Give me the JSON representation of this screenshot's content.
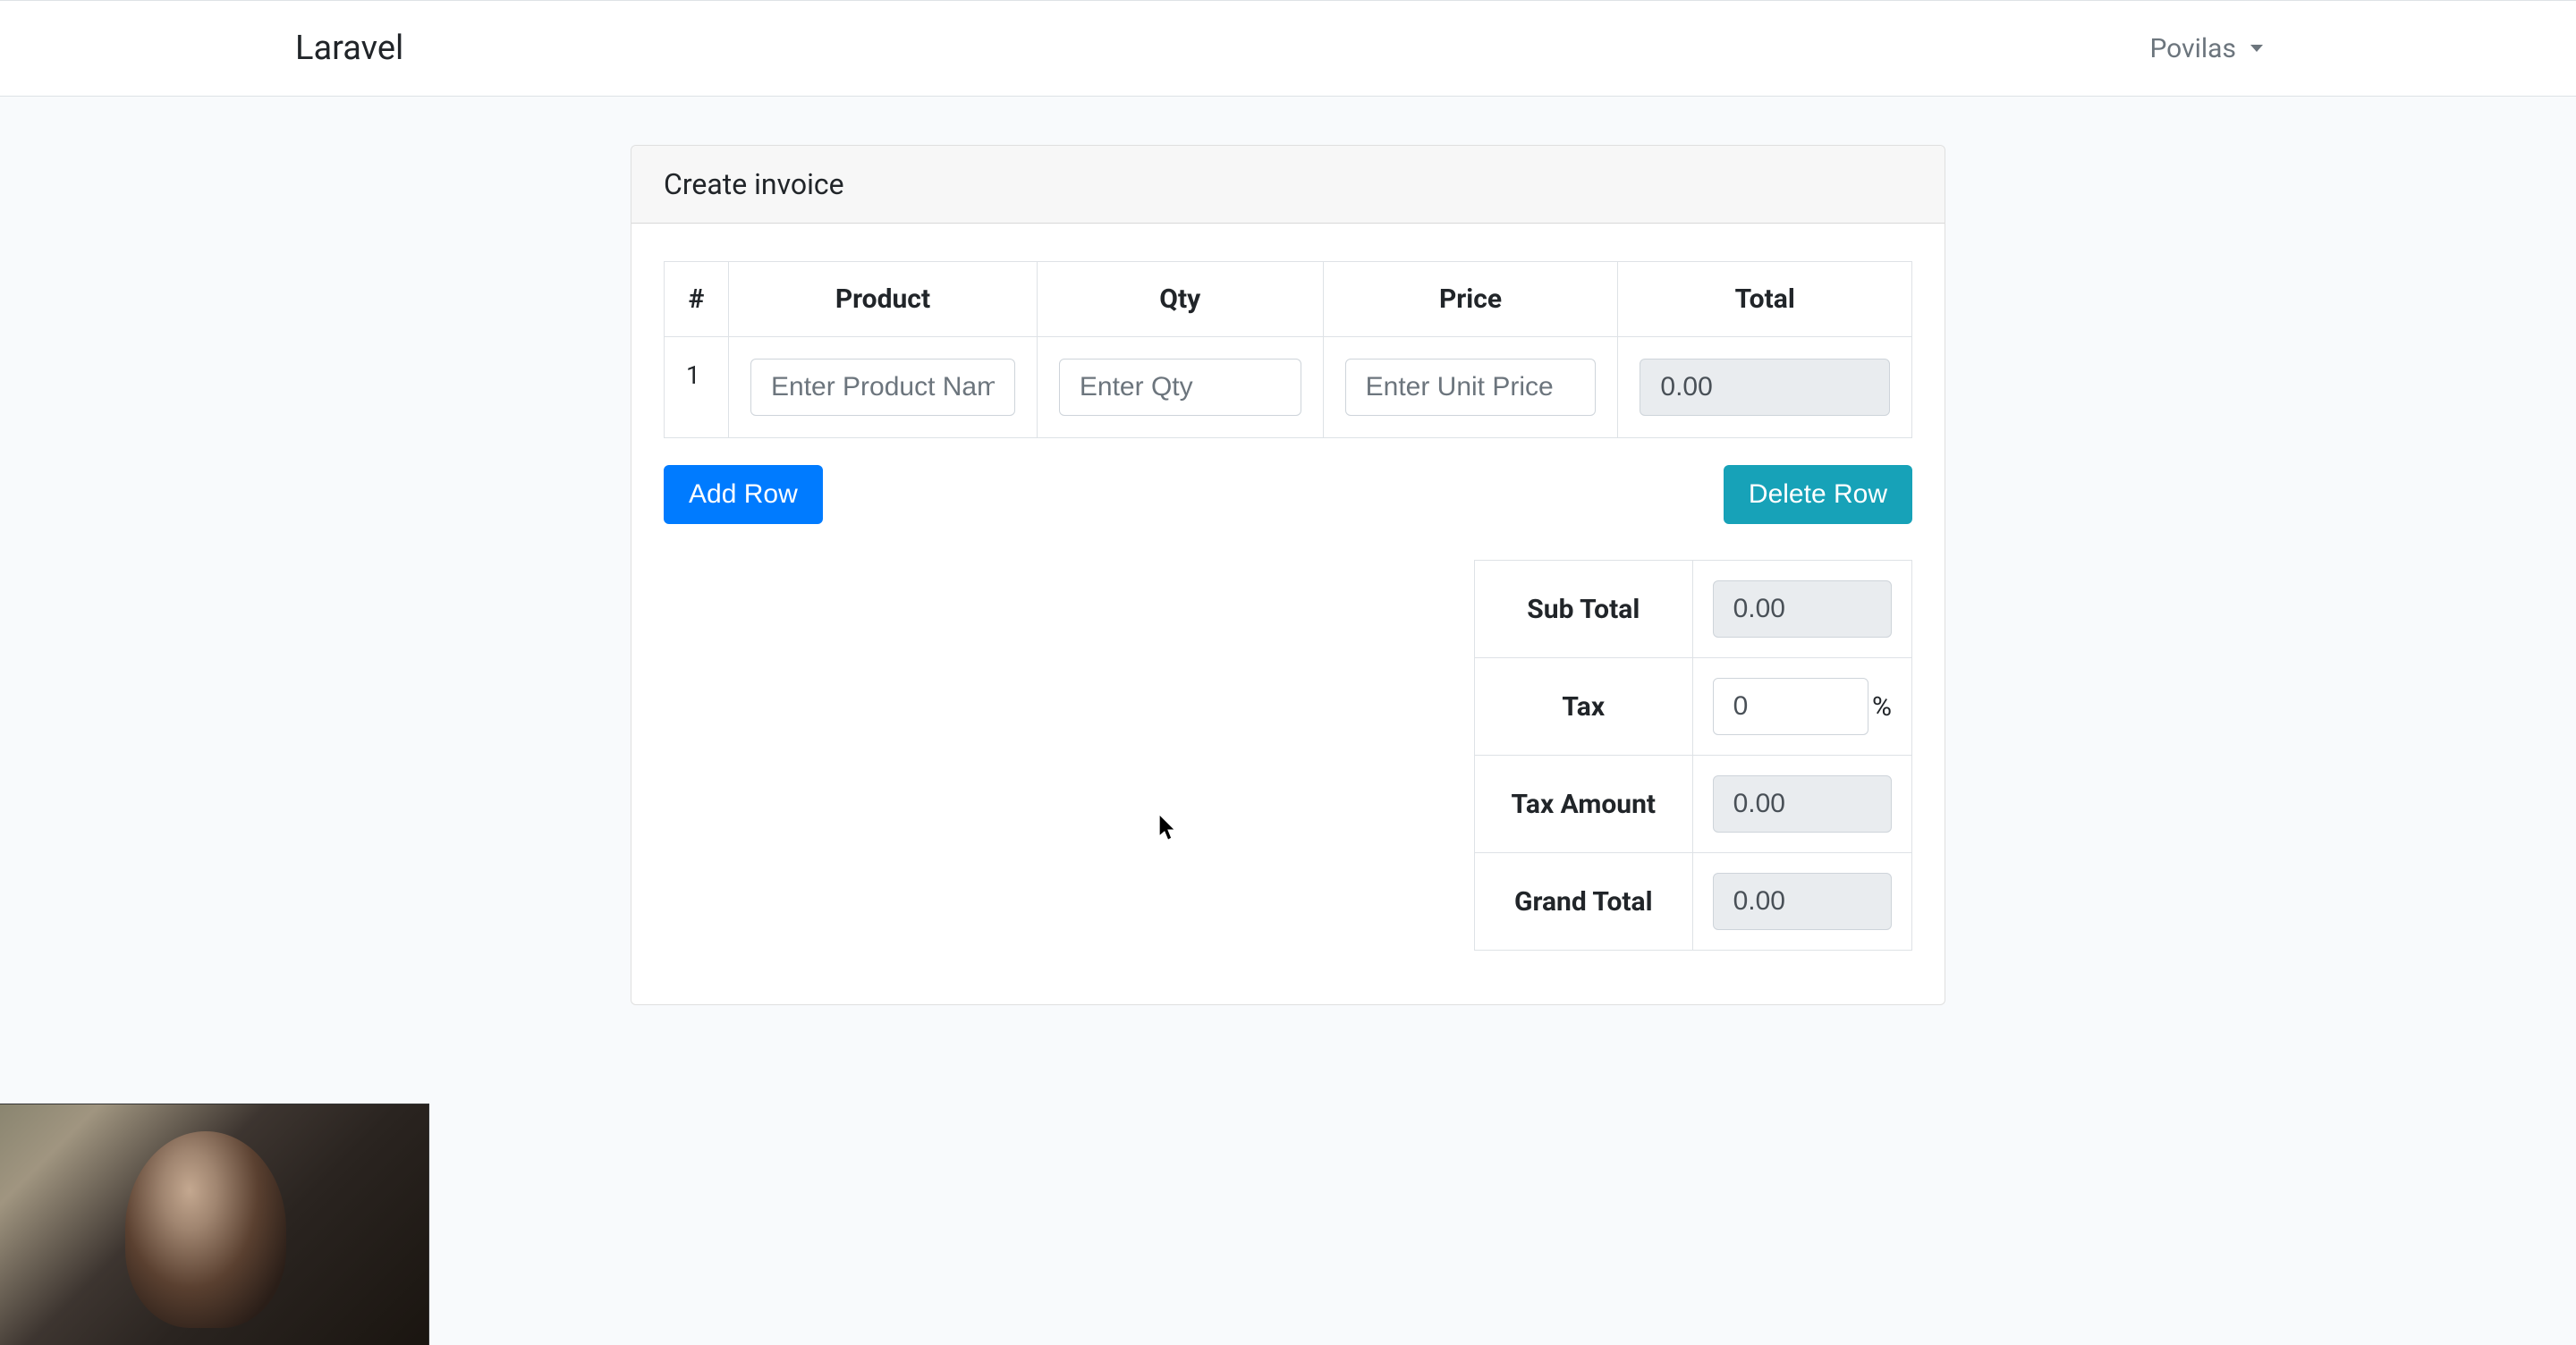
{
  "navbar": {
    "brand": "Laravel",
    "user": "Povilas"
  },
  "card": {
    "title": "Create invoice"
  },
  "table": {
    "headers": {
      "num": "#",
      "product": "Product",
      "qty": "Qty",
      "price": "Price",
      "total": "Total"
    },
    "rows": [
      {
        "num": "1",
        "product_value": "",
        "product_placeholder": "Enter Product Name",
        "qty_value": "",
        "qty_placeholder": "Enter Qty",
        "price_value": "",
        "price_placeholder": "Enter Unit Price",
        "total_value": "0.00"
      }
    ]
  },
  "buttons": {
    "add_row": "Add Row",
    "delete_row": "Delete Row"
  },
  "totals": {
    "sub_total_label": "Sub Total",
    "sub_total_value": "0.00",
    "tax_label": "Tax",
    "tax_value": "0",
    "tax_pct": "%",
    "tax_amount_label": "Tax Amount",
    "tax_amount_value": "0.00",
    "grand_total_label": "Grand Total",
    "grand_total_value": "0.00"
  }
}
